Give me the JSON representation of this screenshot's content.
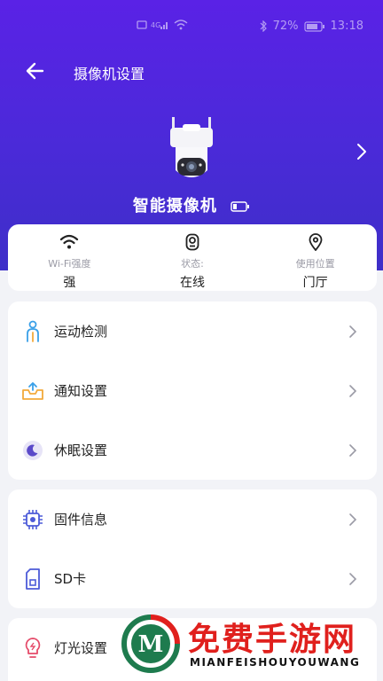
{
  "status_bar": {
    "battery_percent": "72%",
    "time": "13:18"
  },
  "header": {
    "title": "摄像机设置"
  },
  "device": {
    "name": "智能摄像机"
  },
  "info": {
    "wifi": {
      "label": "Wi-Fi强度",
      "value": "强",
      "icon": "wifi-icon"
    },
    "status": {
      "label": "状态:",
      "value": "在线",
      "icon": "camera-status-icon"
    },
    "location": {
      "label": "使用位置",
      "value": "门厅",
      "icon": "location-pin-icon"
    }
  },
  "settings_group_1": [
    {
      "label": "运动检测",
      "icon": "person-motion-icon",
      "color": "#3aa0e8"
    },
    {
      "label": "通知设置",
      "icon": "notification-tray-icon",
      "color": "#f2a93b"
    },
    {
      "label": "休眠设置",
      "icon": "moon-sleep-icon",
      "color": "#5a49c9"
    }
  ],
  "settings_group_2": [
    {
      "label": "固件信息",
      "icon": "chip-icon",
      "color": "#4d5bd8"
    },
    {
      "label": "SD卡",
      "icon": "sd-card-icon",
      "color": "#4d5bd8"
    }
  ],
  "settings_group_3": [
    {
      "label": "灯光设置",
      "icon": "bulb-icon",
      "color": "#e54b6a"
    }
  ],
  "watermark": {
    "title": "免费手游网",
    "subtitle": "MIANFEISHOUYOUWANG"
  },
  "colors": {
    "hero_top": "#5a22e6",
    "hero_bottom": "#3e2fc8",
    "background": "#f2f3f7"
  }
}
